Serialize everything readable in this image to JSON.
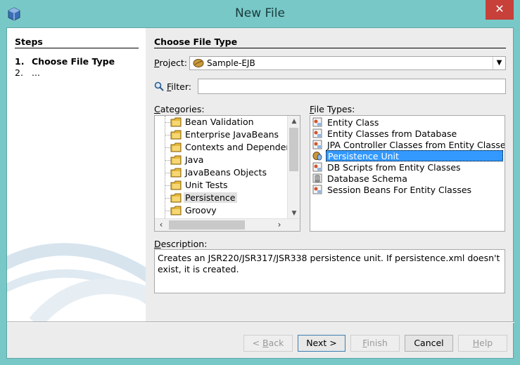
{
  "window": {
    "title": "New File",
    "close_label": "✕"
  },
  "steps": {
    "title": "Steps",
    "items": [
      {
        "num": "1.",
        "label": "Choose File Type"
      },
      {
        "num": "2.",
        "label": "..."
      }
    ]
  },
  "main": {
    "section_title": "Choose File Type",
    "project_label_u": "P",
    "project_label_rest": "roject:",
    "project_value": "Sample-EJB",
    "filter_label_u": "F",
    "filter_label_rest": "ilter:",
    "filter_value": "",
    "categories_label_u": "C",
    "categories_label_rest": "ategories:",
    "file_types_label_u": "F",
    "file_types_label_rest": "ile Types:",
    "description_label_u": "D",
    "description_label_rest": "escription:",
    "description_text": "Creates an JSR220/JSR317/JSR338 persistence unit. If persistence.xml doesn't exist, it is created."
  },
  "categories": [
    {
      "label": "Bean Validation",
      "selected": false
    },
    {
      "label": "Enterprise JavaBeans",
      "selected": false
    },
    {
      "label": "Contexts and Dependency Injection",
      "selected": false
    },
    {
      "label": "Java",
      "selected": false
    },
    {
      "label": "JavaBeans Objects",
      "selected": false
    },
    {
      "label": "Unit Tests",
      "selected": false
    },
    {
      "label": "Persistence",
      "selected": true
    },
    {
      "label": "Groovy",
      "selected": false
    }
  ],
  "file_types": [
    {
      "label": "Entity Class",
      "icon": "entity-class-icon",
      "selected": false
    },
    {
      "label": "Entity Classes from Database",
      "icon": "entity-db-icon",
      "selected": false
    },
    {
      "label": "JPA Controller Classes from Entity Classes",
      "icon": "jpa-controller-icon",
      "selected": false
    },
    {
      "label": "Persistence Unit",
      "icon": "persistence-unit-icon",
      "selected": true
    },
    {
      "label": "DB Scripts from Entity Classes",
      "icon": "db-scripts-icon",
      "selected": false
    },
    {
      "label": "Database Schema",
      "icon": "database-schema-icon",
      "selected": false
    },
    {
      "label": "Session Beans For Entity Classes",
      "icon": "session-beans-icon",
      "selected": false
    }
  ],
  "buttons": {
    "back_prefix": "< ",
    "back_u": "B",
    "back_rest": "ack",
    "next": "Next >",
    "finish_u": "F",
    "finish_rest": "inish",
    "cancel": "Cancel",
    "help_u": "H",
    "help_rest": "elp"
  },
  "colors": {
    "selection": "#3399ff",
    "close": "#c7403a",
    "frame": "#78c8c8"
  }
}
